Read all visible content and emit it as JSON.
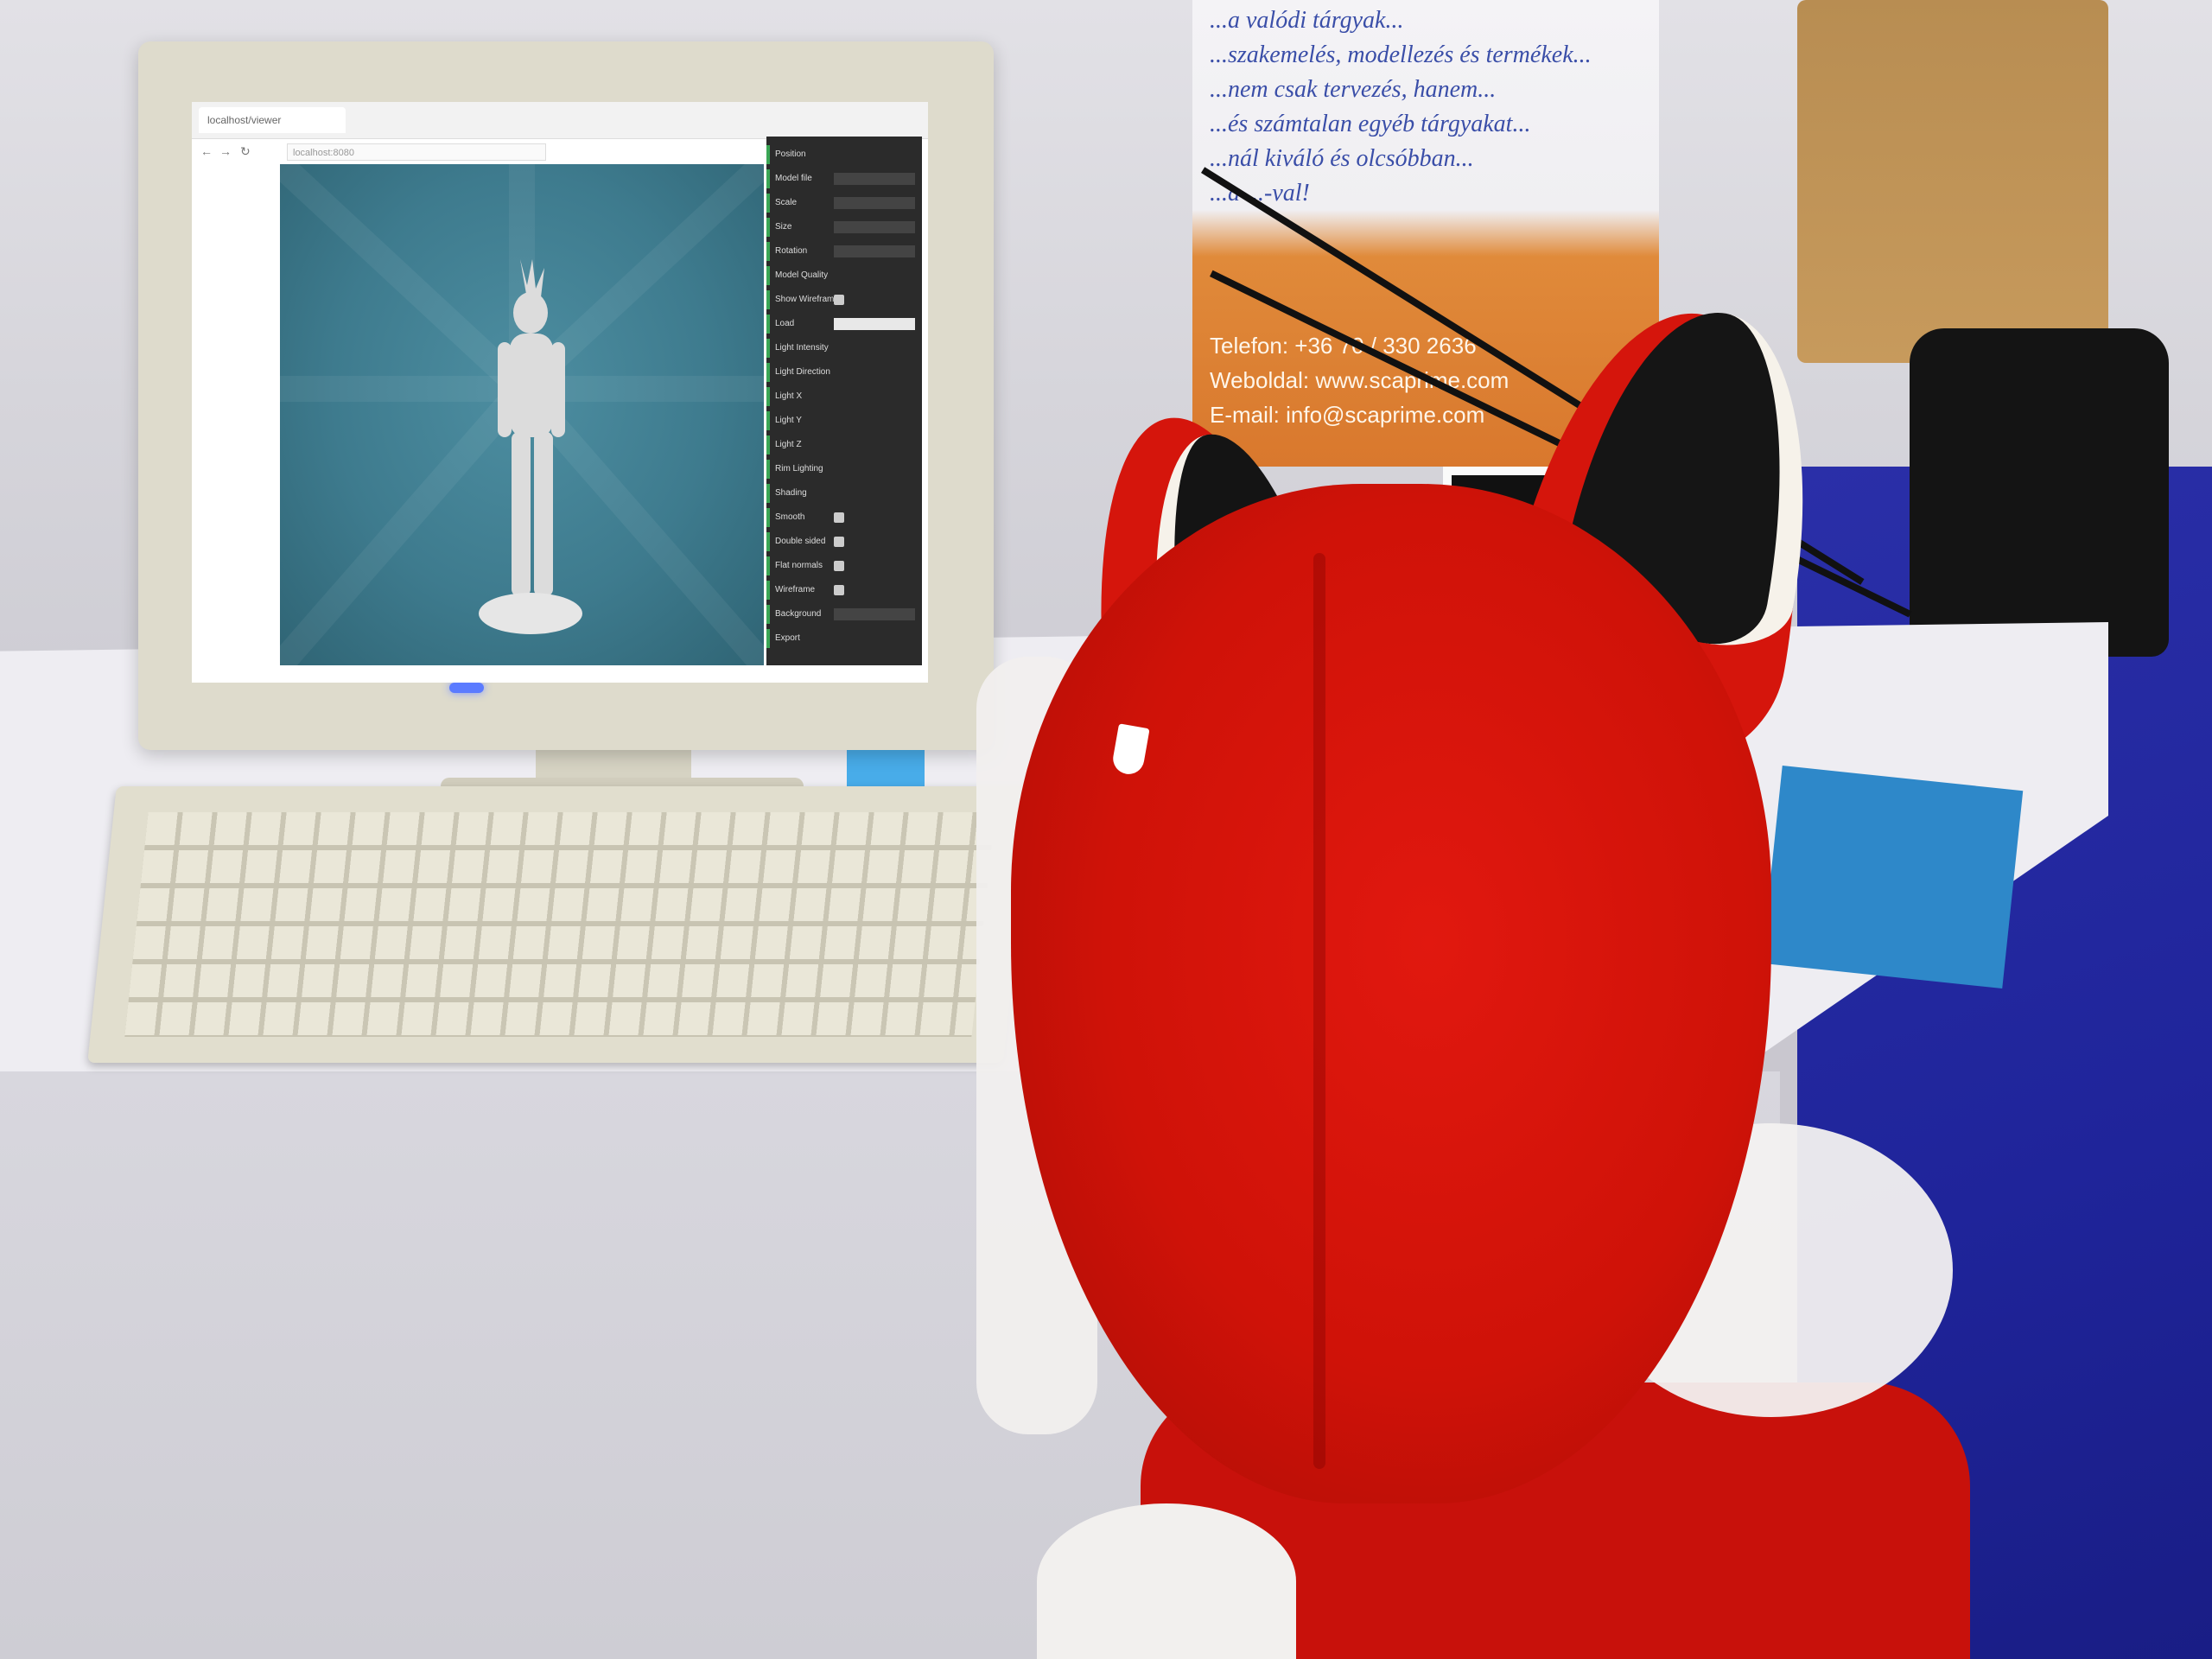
{
  "scene": {
    "description_elements": [
      "monitor",
      "keyboard",
      "fox-hat",
      "banner",
      "table"
    ]
  },
  "banner": {
    "lines_top": [
      "...a valódi tárgyak...",
      "...szakemelés, modellezés és termékek...",
      "...nem csak tervezés, hanem...",
      "...és számtalan egyéb tárgyakat...",
      "...nál kiváló és olcsóbban...",
      "...a ...-val!"
    ],
    "contact": {
      "phone": "Telefon: +36 70 / 330 2636",
      "web": "Weboldal: www.scaprime.com",
      "email": "E-mail: info@scaprime.com"
    }
  },
  "browser": {
    "tab_title": "localhost/viewer",
    "address": "localhost:8080",
    "back_icon": "back-arrow-icon",
    "forward_icon": "forward-arrow-icon",
    "reload_icon": "reload-icon"
  },
  "side_panel": {
    "rows": [
      {
        "label": "Position",
        "control": "none"
      },
      {
        "label": "Model file",
        "control": "field"
      },
      {
        "label": "Scale",
        "control": "field"
      },
      {
        "label": "Size",
        "control": "field"
      },
      {
        "label": "Rotation",
        "control": "field"
      },
      {
        "label": "Model Quality",
        "control": "none"
      },
      {
        "label": "Show Wireframe",
        "control": "checkbox"
      },
      {
        "label": "Load",
        "control": "button"
      },
      {
        "label": "Light Intensity",
        "control": "none"
      },
      {
        "label": "Light Direction",
        "control": "none"
      },
      {
        "label": "Light X",
        "control": "none"
      },
      {
        "label": "Light Y",
        "control": "none"
      },
      {
        "label": "Light Z",
        "control": "none"
      },
      {
        "label": "Rim Lighting",
        "control": "none"
      },
      {
        "label": "Shading",
        "control": "none"
      },
      {
        "label": "Smooth",
        "control": "checkbox"
      },
      {
        "label": "Double sided",
        "control": "checkbox"
      },
      {
        "label": "Flat normals",
        "control": "checkbox"
      },
      {
        "label": "Wireframe",
        "control": "checkbox"
      },
      {
        "label": "Background",
        "control": "field"
      },
      {
        "label": "Export",
        "control": "none"
      }
    ]
  },
  "colors": {
    "viewport": "#3e7b8e",
    "panel": "#2b2b2b",
    "accent": "#3aa655",
    "fox_red": "#d5150c",
    "carpet_blue": "#1f249a"
  }
}
